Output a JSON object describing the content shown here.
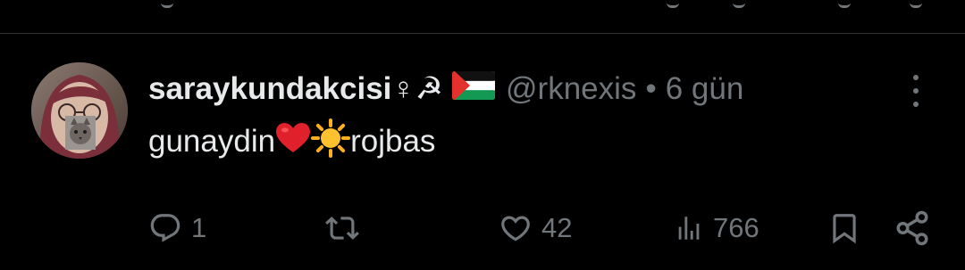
{
  "tweet": {
    "display_name": "saraykundakcisi♀☭",
    "flag_icon": "palestine-flag-icon",
    "handle": "@rknexis",
    "separator": "•",
    "time": "6 gün",
    "text_part1": "gunaydin ",
    "text_part2": "rojbas",
    "emojis": [
      "red-heart-emoji",
      "sun-emoji"
    ]
  },
  "actions": {
    "reply_count": "1",
    "retweet_count": "",
    "like_count": "42",
    "view_count": "766"
  },
  "colors": {
    "background": "#000000",
    "text": "#e7e9ea",
    "muted": "#71767b",
    "divider": "#2f3336",
    "heart": "#e0202b",
    "sun": "#ffb01f"
  }
}
